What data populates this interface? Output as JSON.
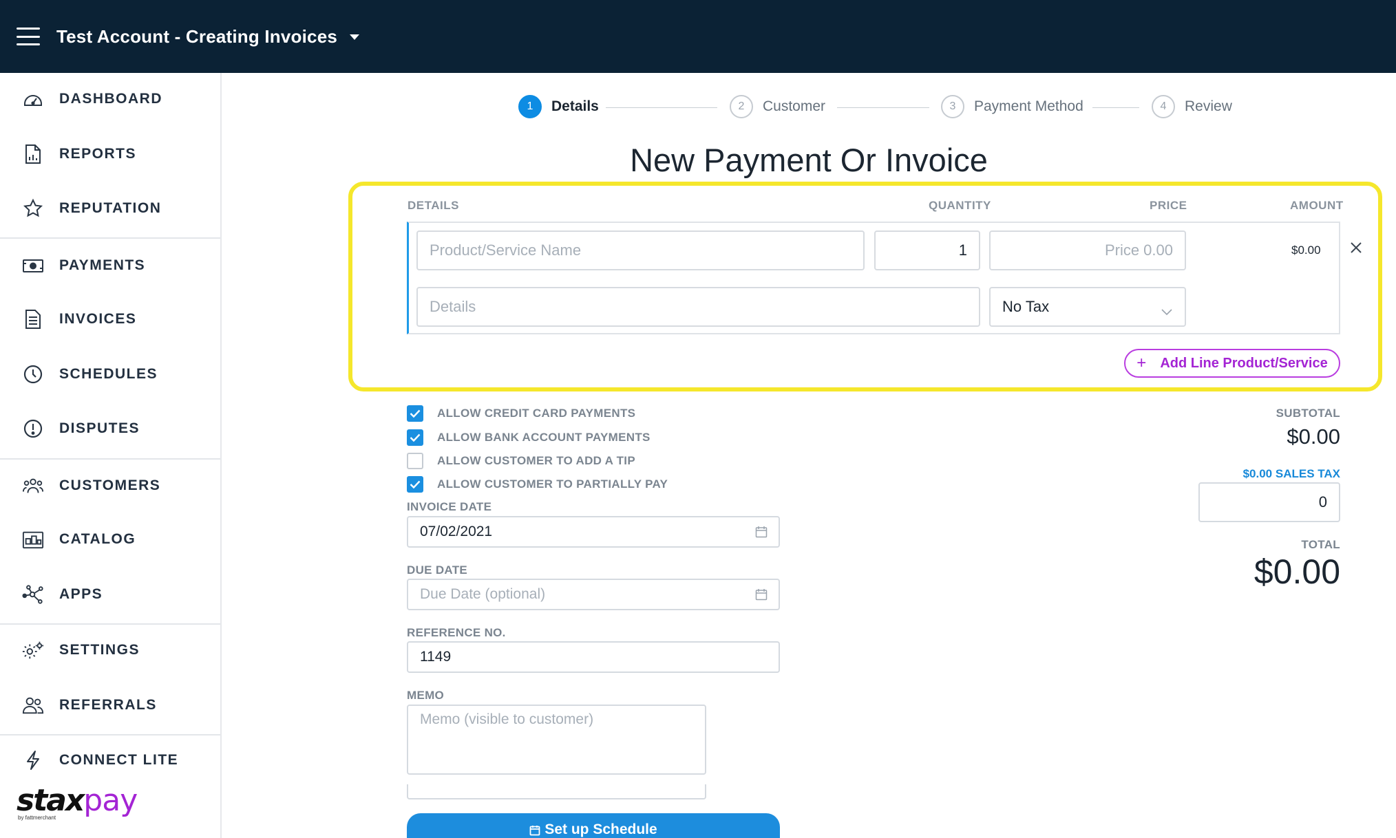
{
  "header": {
    "account_title": "Test Account - Creating Invoices"
  },
  "sidebar": {
    "items": [
      {
        "label": "DASHBOARD",
        "icon": "dashboard-icon"
      },
      {
        "label": "REPORTS",
        "icon": "report-icon"
      },
      {
        "label": "REPUTATION",
        "icon": "star-icon"
      },
      {
        "label": "PAYMENTS",
        "icon": "cash-icon"
      },
      {
        "label": "INVOICES",
        "icon": "invoice-icon"
      },
      {
        "label": "SCHEDULES",
        "icon": "clock-icon"
      },
      {
        "label": "DISPUTES",
        "icon": "alert-icon"
      },
      {
        "label": "CUSTOMERS",
        "icon": "customers-icon"
      },
      {
        "label": "CATALOG",
        "icon": "catalog-icon"
      },
      {
        "label": "APPS",
        "icon": "apps-icon"
      },
      {
        "label": "SETTINGS",
        "icon": "gear-icon"
      },
      {
        "label": "REFERRALS",
        "icon": "referrals-icon"
      },
      {
        "label": "CONNECT LITE",
        "icon": "lightning-icon"
      }
    ],
    "brand": {
      "name_part1": "stax",
      "name_part2": "pay",
      "tagline": "by fattmerchant"
    }
  },
  "stepper": {
    "steps": [
      {
        "number": "1",
        "label": "Details"
      },
      {
        "number": "2",
        "label": "Customer"
      },
      {
        "number": "3",
        "label": "Payment Method"
      },
      {
        "number": "4",
        "label": "Review"
      }
    ]
  },
  "page_title": "New Payment Or Invoice",
  "line_items": {
    "headers": {
      "details": "DETAILS",
      "quantity": "QUANTITY",
      "price": "PRICE",
      "amount": "AMOUNT"
    },
    "name_placeholder": "Product/Service Name",
    "quantity": "1",
    "price_placeholder": "Price 0.00",
    "amount": "$0.00",
    "details_placeholder": "Details",
    "tax_select": "No Tax",
    "add_line_label": "Add Line Product/Service"
  },
  "options": [
    {
      "label": "ALLOW CREDIT CARD PAYMENTS",
      "checked": true
    },
    {
      "label": "ALLOW BANK ACCOUNT PAYMENTS",
      "checked": true
    },
    {
      "label": "ALLOW CUSTOMER TO ADD A TIP",
      "checked": false
    },
    {
      "label": "ALLOW CUSTOMER TO PARTIALLY PAY",
      "checked": true
    }
  ],
  "form": {
    "invoice_date_label": "INVOICE DATE",
    "invoice_date": "07/02/2021",
    "due_date_label": "DUE DATE",
    "due_date_placeholder": "Due Date (optional)",
    "reference_label": "REFERENCE NO.",
    "reference": "1149",
    "memo_label": "MEMO",
    "memo_placeholder": "Memo (visible to customer)",
    "schedule_button": "Set up Schedule"
  },
  "totals": {
    "subtotal_label": "SUBTOTAL",
    "subtotal": "$0.00",
    "sales_tax_link": "$0.00 SALES TAX",
    "sales_tax_value": "0",
    "total_label": "TOTAL",
    "total": "$0.00"
  },
  "colors": {
    "header_bg": "#0b2235",
    "accent_blue": "#1a8fe0",
    "accent_purple": "#a424d4",
    "highlight_yellow": "#f5e72c"
  }
}
